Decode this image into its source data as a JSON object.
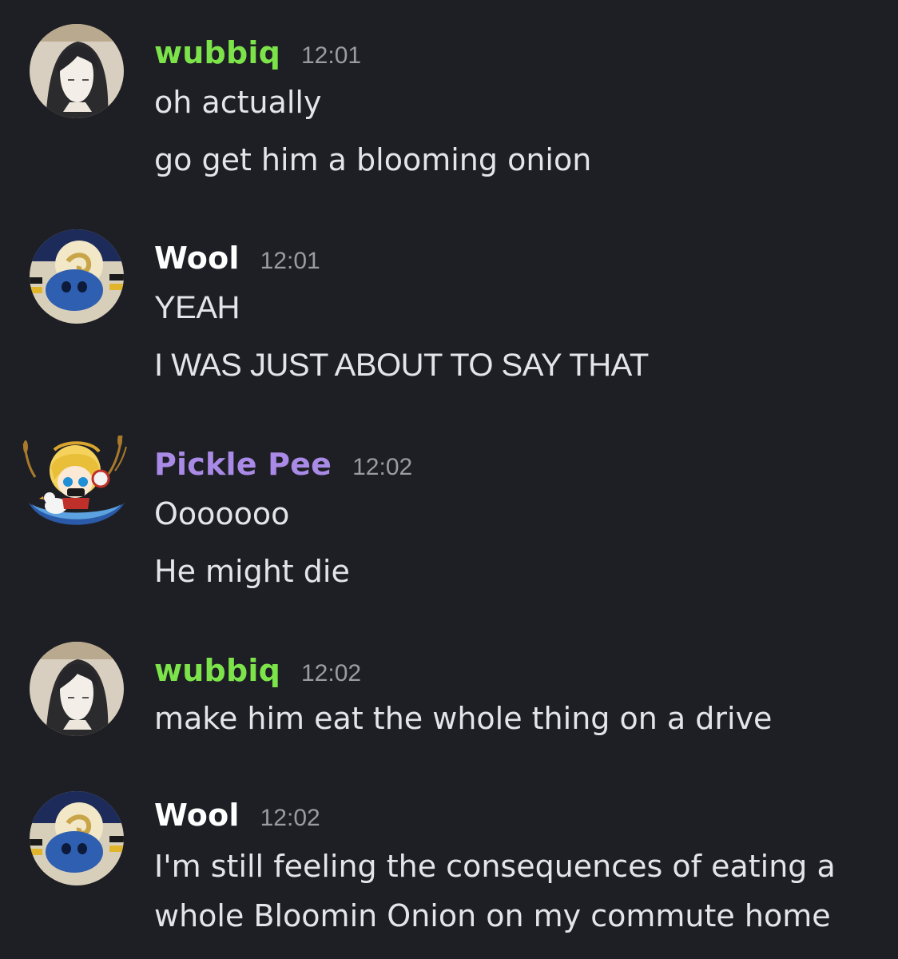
{
  "colors": {
    "background": "#1e1f24",
    "message_text": "#e3e5e8",
    "timestamp": "#9a9ba3",
    "wubbiq_name": "#7de34a",
    "wool_name": "#ffffff",
    "pickle_name": "#a98ae6"
  },
  "messages": [
    {
      "author": "wubbiq",
      "time": "12:01",
      "avatar_icon": "dark-haired-character-avatar",
      "lines": [
        "oh actually",
        "go get him a blooming onion"
      ]
    },
    {
      "author": "Wool",
      "time": "12:01",
      "avatar_icon": "blue-sheep-mareep-avatar",
      "lines": [
        "YEAH",
        "I WAS JUST ABOUT TO SAY THAT"
      ]
    },
    {
      "author": "Pickle Pee",
      "time": "12:02",
      "avatar_icon": "blonde-character-headphones-duck-avatar",
      "lines": [
        "Ooooooo",
        "He might die"
      ]
    },
    {
      "author": "wubbiq",
      "time": "12:02",
      "avatar_icon": "dark-haired-character-avatar",
      "lines": [
        "make him eat the whole thing on a drive"
      ]
    },
    {
      "author": "Wool",
      "time": "12:02",
      "avatar_icon": "blue-sheep-mareep-avatar",
      "lines": [
        "I'm still feeling the consequences of eating a",
        "whole Bloomin Onion on my commute home"
      ]
    }
  ]
}
